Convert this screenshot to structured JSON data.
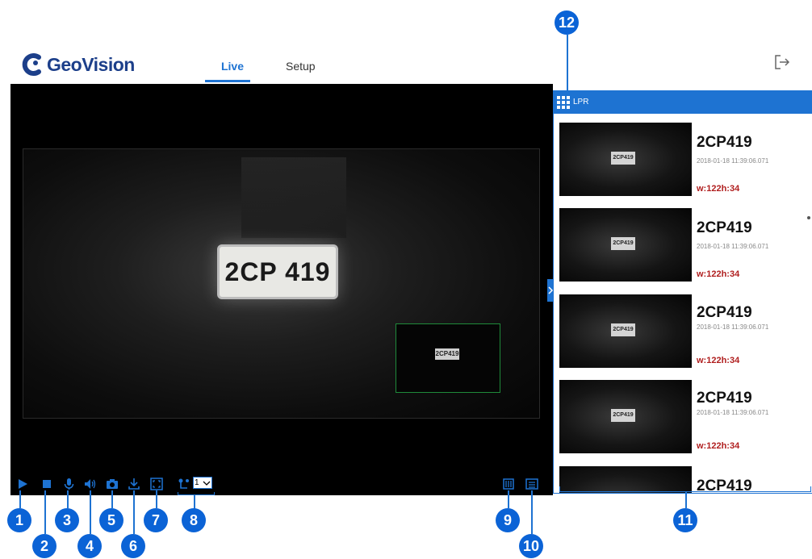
{
  "header": {
    "brand": "GeoVision",
    "tabs": [
      {
        "label": "Live",
        "active": true
      },
      {
        "label": "Setup",
        "active": false
      }
    ],
    "logout_icon": "logout-icon"
  },
  "video": {
    "plate_text": "2CP 419",
    "roi_plate_text": "2CP419",
    "roi_color": "#1f8a3a"
  },
  "toolbar": {
    "buttons": [
      {
        "icon": "play-icon"
      },
      {
        "icon": "stop-icon"
      },
      {
        "icon": "microphone-icon"
      },
      {
        "icon": "speaker-icon"
      },
      {
        "icon": "snapshot-icon"
      },
      {
        "icon": "download-icon"
      },
      {
        "icon": "fullscreen-icon"
      },
      {
        "icon": "stream-icon"
      }
    ],
    "stream_value": "1",
    "right_buttons": [
      {
        "icon": "io-icon"
      },
      {
        "icon": "list-icon"
      }
    ],
    "accent": "#1e73d2"
  },
  "lpr": {
    "title": "LPR",
    "items": [
      {
        "plate": "2CP419",
        "time": "2018-01-18 11:39:06.071",
        "size": "w:122h:34",
        "thumb_plate": "2CP419"
      },
      {
        "plate": "2CP419",
        "time": "2018-01-18 11:39:06.071",
        "size": "w:122h:34",
        "thumb_plate": "2CP419"
      },
      {
        "plate": "2CP419",
        "time": "2018-01-18 11:39:06.071",
        "size": "w:122h:34",
        "thumb_plate": "2CP419"
      },
      {
        "plate": "2CP419",
        "time": "2018-01-18 11:39:06.071",
        "size": "w:122h:34",
        "thumb_plate": "2CP419"
      },
      {
        "plate": "2CP419"
      }
    ]
  },
  "callouts": [
    "1",
    "2",
    "3",
    "4",
    "5",
    "6",
    "7",
    "8",
    "9",
    "10",
    "11",
    "12"
  ],
  "callout_color": "#0b63d6"
}
